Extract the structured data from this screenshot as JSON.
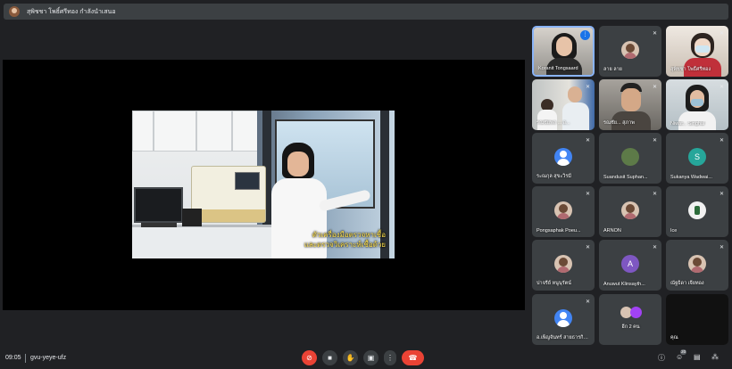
{
  "presenter_banner": {
    "text": "สุพิชชา โพธิ์ศรีทอง กำลังนำเสนอ"
  },
  "video": {
    "subtitle_line1": "ตัวเครื่องมือตรวจหาเชื้อ",
    "subtitle_line2": "และตรวจวิเคราะห์เชื้อด้วย"
  },
  "participants": [
    {
      "name": "Koranit Tongsaard",
      "speaking": true
    },
    {
      "name": "ลาย ลาย"
    },
    {
      "name": "สุพิชชา โพธิ์ศรีทอง"
    },
    {
      "name": "รณชัยพล ... อ..."
    },
    {
      "name": "รณชัย... สุภาพ"
    },
    {
      "name": "Niwat... Singhal"
    },
    {
      "name": "ระณกุล สุขะวิรมี"
    },
    {
      "name": "Suandusit Suphan..."
    },
    {
      "name": "Sukanya Wadwai...",
      "initial": "S"
    },
    {
      "name": "Pongsaphak Poeu..."
    },
    {
      "name": "ARNON"
    },
    {
      "name": "Ice"
    },
    {
      "name": "ปาจรีย์ หนูนุรัตน์"
    },
    {
      "name": "Anuwut Klinsayth...",
      "initial": "A"
    },
    {
      "name": "ณัฐธิดา เจียทอง"
    },
    {
      "name": "อ.เพ็ญจันทร์ สายธารกิจพิ..."
    },
    {
      "name": "อีก 2 คน"
    },
    {
      "name": "คุณ"
    }
  ],
  "bottom_bar": {
    "time": "09:05",
    "meeting_code": "gvu-yeye-ufz",
    "participant_count": "20",
    "icons": {
      "mic": "mic-off-icon",
      "camera": "camera-icon",
      "hand": "raise-hand-icon",
      "present": "present-icon",
      "more": "more-icon",
      "leave": "hang-up-icon",
      "info": "info-icon",
      "people": "people-icon",
      "chat": "chat-icon",
      "activities": "activities-icon"
    }
  },
  "colors": {
    "background": "#202124",
    "tile": "#3c4043",
    "accent": "#8ab4f8",
    "leave": "#ea4335"
  }
}
